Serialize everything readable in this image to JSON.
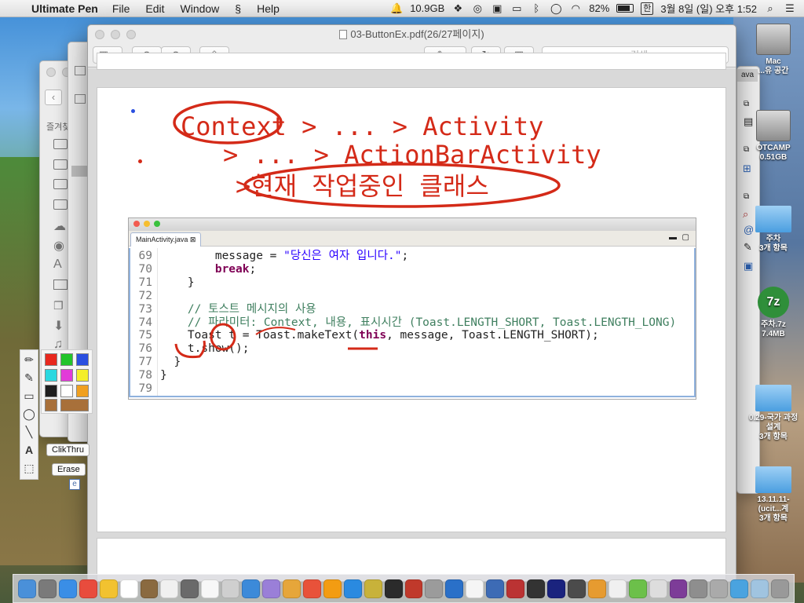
{
  "menubar": {
    "app_name": "Ultimate Pen",
    "menus": [
      "File",
      "Edit",
      "Window",
      "Help"
    ],
    "disk_free": "10.9GB",
    "battery": "82%",
    "battery_level": 0.82,
    "input_method": "한",
    "datetime": "3월 8일 (일) 오후 1:52"
  },
  "window": {
    "title": "03-ButtonEx.pdf(26/27페이지)",
    "search_placeholder": "검색"
  },
  "slide": {
    "line1": "Context > ... > Activity",
    "line2": "> ... > ActionBarActivity",
    "line3": ">현재 작업중인 클래스"
  },
  "editor": {
    "tab_label": "MainActivity.java",
    "lines": [
      {
        "num": "69",
        "code": "        message = \"당신은 여자 입니다.\";"
      },
      {
        "num": "70",
        "code": "        break;"
      },
      {
        "num": "71",
        "code": "    }"
      },
      {
        "num": "72",
        "code": ""
      },
      {
        "num": "73",
        "code": "    // 토스트 메시지의 사용"
      },
      {
        "num": "74",
        "code": "    // 파라미터: Context, 내용, 표시시간 (Toast.LENGTH_SHORT, Toast.LENGTH_LONG)"
      },
      {
        "num": "75",
        "code": "    Toast t = Toast.makeText(this, message, Toast.LENGTH_SHORT);"
      },
      {
        "num": "76",
        "code": "    t.show();"
      },
      {
        "num": "77",
        "code": "  }"
      },
      {
        "num": "78",
        "code": "}"
      },
      {
        "num": "79",
        "code": ""
      }
    ]
  },
  "tools": {
    "clickthru_label": "ClikThru",
    "erase_label": "Erase"
  },
  "swatch_colors": [
    "#e8281e",
    "#22c42a",
    "#2a4fe0",
    "#2ad8e0",
    "#e23ad8",
    "#f4ee2a",
    "#1e1e1e",
    "#ffffff",
    "#f0a020",
    "#a8703a",
    "#a8703a"
  ],
  "sidebar_left": {
    "label": "즐겨찾"
  },
  "desktop": {
    "items": [
      {
        "label": "Mac",
        "sub": "...유 공간"
      },
      {
        "label": "OTCAMP",
        "sub": "0.51GB"
      },
      {
        "label": "주차",
        "sub": "3개 항목"
      },
      {
        "label": "주차.7z",
        "sub": "7.4MB"
      },
      {
        "label": "0.29-국가 과정설계",
        "sub": "3개 항목"
      },
      {
        "label": "13.11.11- (ucit...계",
        "sub": "3개 항목"
      }
    ],
    "java_label": "ava"
  }
}
